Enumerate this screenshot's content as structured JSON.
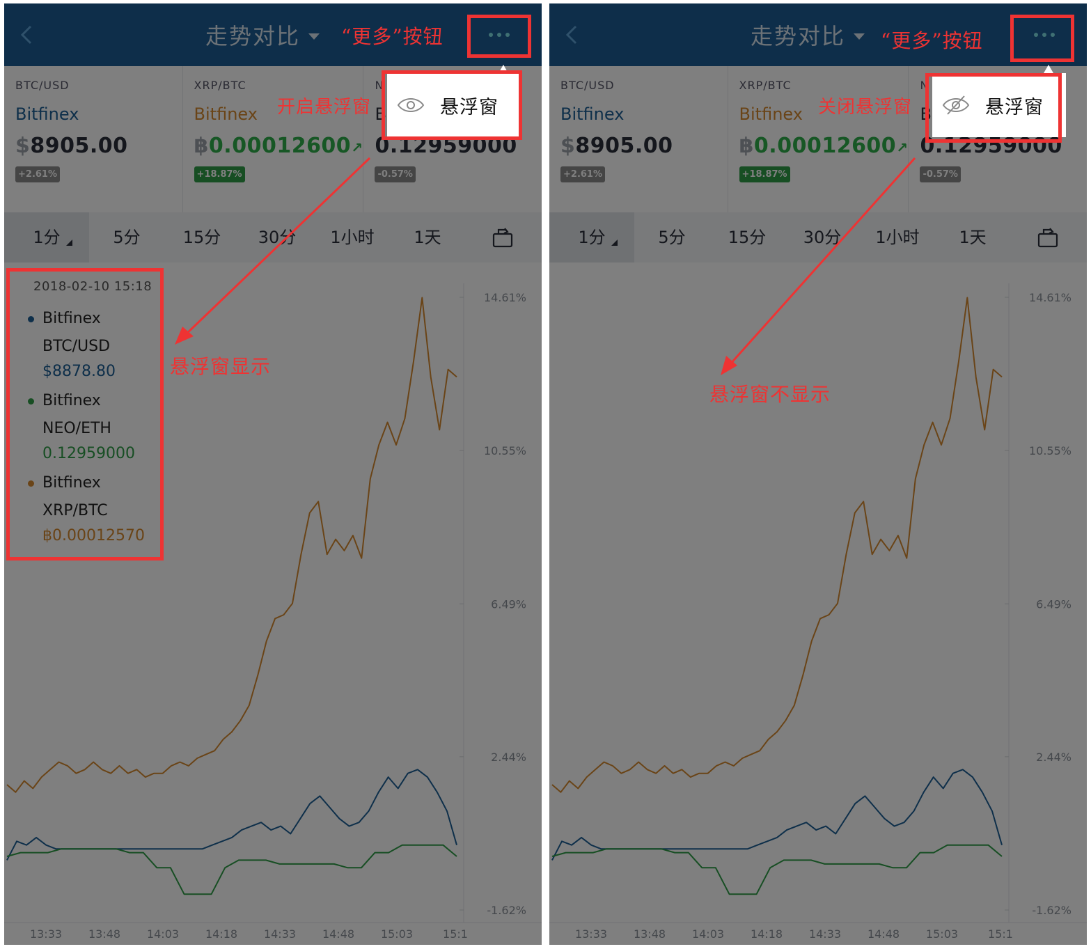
{
  "panels": [
    {
      "header_title": "走势对比",
      "tickers": [
        {
          "pair": "BTC/USD",
          "exchange": "Bitfinex",
          "price_symbol": "$",
          "price": "8905.00",
          "change": "+2.61%",
          "exchange_color": "#1d5f95",
          "badge_color": "#8a8a8a",
          "price_color": "#2a2f3a"
        },
        {
          "pair": "XRP/BTC",
          "exchange": "Bitfinex",
          "price_symbol": "฿",
          "price": "0.00012600",
          "trend_arrow": "↗",
          "change": "+18.87%",
          "exchange_color": "#d4892f",
          "badge_color": "#2e9c47",
          "price_color": "#2fae4a"
        },
        {
          "pair": "N",
          "exchange": "B",
          "price_symbol": "",
          "price": "0.12959000",
          "change": "-0.57%",
          "exchange_color": "#2a2f3a",
          "badge_color": "#8a8a8a",
          "price_color": "#2a2f3a"
        }
      ],
      "tabs": [
        "1分",
        "5分",
        "15分",
        "30分",
        "1小时",
        "1天"
      ],
      "popup_label": "悬浮窗",
      "tooltip": {
        "date": "2018-02-10 15:18",
        "rows": [
          {
            "exchange": "Bitfinex",
            "pair": "BTC/USD",
            "value": "$8878.80",
            "color": "#1d5f95"
          },
          {
            "exchange": "Bitfinex",
            "pair": "NEO/ETH",
            "value": "0.12959000",
            "color": "#2e9c47"
          },
          {
            "exchange": "Bitfinex",
            "pair": "XRP/BTC",
            "value": "฿0.00012570",
            "color": "#d4892f"
          }
        ]
      },
      "annotations": {
        "more_button": "“更多”按钮",
        "toggle": "开启悬浮窗",
        "result": "悬浮窗显示"
      }
    },
    {
      "header_title": "走势对比",
      "tickers": [
        {
          "pair": "BTC/USD",
          "exchange": "Bitfinex",
          "price_symbol": "$",
          "price": "8905.00",
          "change": "+2.61%",
          "exchange_color": "#1d5f95",
          "badge_color": "#8a8a8a",
          "price_color": "#2a2f3a"
        },
        {
          "pair": "XRP/BTC",
          "exchange": "Bitfinex",
          "price_symbol": "฿",
          "price": "0.00012600",
          "trend_arrow": "↗",
          "change": "+18.87%",
          "exchange_color": "#d4892f",
          "badge_color": "#2e9c47",
          "price_color": "#2fae4a"
        },
        {
          "pair": "N",
          "exchange": "B",
          "price_symbol": "",
          "price": "0.12959000",
          "change": "-0.57%",
          "exchange_color": "#2a2f3a",
          "badge_color": "#8a8a8a",
          "price_color": "#2a2f3a"
        }
      ],
      "tabs": [
        "1分",
        "5分",
        "15分",
        "30分",
        "1小时",
        "1天"
      ],
      "popup_label": "悬浮窗",
      "annotations": {
        "more_button": "“更多”按钮",
        "toggle": "关闭悬浮窗",
        "result": "悬浮窗不显示"
      }
    }
  ],
  "chart_data": {
    "type": "line",
    "x": [
      "13:33",
      "13:48",
      "14:03",
      "14:18",
      "14:33",
      "14:48",
      "15:03",
      "15:1"
    ],
    "y_ticks": [
      "14.61%",
      "10.55%",
      "6.49%",
      "2.44%",
      "-1.62%"
    ],
    "ylim": [
      -1.62,
      14.61
    ],
    "series": [
      {
        "name": "XRP/BTC",
        "color": "#d4892f",
        "values": [
          1.7,
          1.5,
          1.8,
          1.6,
          1.9,
          2.1,
          2.3,
          2.2,
          2.0,
          2.1,
          2.3,
          2.1,
          2.0,
          2.2,
          2.0,
          2.1,
          1.9,
          2.0,
          2.0,
          2.2,
          2.3,
          2.2,
          2.4,
          2.5,
          2.6,
          2.9,
          3.1,
          3.4,
          3.8,
          4.6,
          5.5,
          6.1,
          6.2,
          6.5,
          7.8,
          8.9,
          9.2,
          7.8,
          8.2,
          7.9,
          8.3,
          7.7,
          9.8,
          10.7,
          11.3,
          10.7,
          11.4,
          12.9,
          14.6,
          12.5,
          11.1,
          12.7,
          12.5
        ]
      },
      {
        "name": "BTC/USD",
        "color": "#1d5f95",
        "values": [
          -0.3,
          0.2,
          0.1,
          0.3,
          0.1,
          0.0,
          0.0,
          0.0,
          0.0,
          0.0,
          0.0,
          0.0,
          0.0,
          0.0,
          0.0,
          0.0,
          0.0,
          0.0,
          0.0,
          0.0,
          0.0,
          0.1,
          0.2,
          0.3,
          0.5,
          0.6,
          0.7,
          0.5,
          0.6,
          0.4,
          0.8,
          1.2,
          1.4,
          1.1,
          0.8,
          0.6,
          0.7,
          1.0,
          1.5,
          1.9,
          1.6,
          2.0,
          2.1,
          1.9,
          1.5,
          1.0,
          0.1
        ]
      },
      {
        "name": "NEO/ETH",
        "color": "#2e9c47",
        "values": [
          -0.2,
          -0.1,
          -0.1,
          -0.1,
          0.0,
          0.0,
          0.0,
          0.0,
          0.0,
          -0.1,
          -0.1,
          -0.5,
          -0.5,
          -1.2,
          -1.2,
          -1.2,
          -0.5,
          -0.3,
          -0.3,
          -0.3,
          -0.4,
          -0.4,
          -0.4,
          -0.4,
          -0.4,
          -0.5,
          -0.5,
          -0.1,
          -0.1,
          0.1,
          0.1,
          0.1,
          0.1,
          -0.2
        ]
      }
    ]
  }
}
